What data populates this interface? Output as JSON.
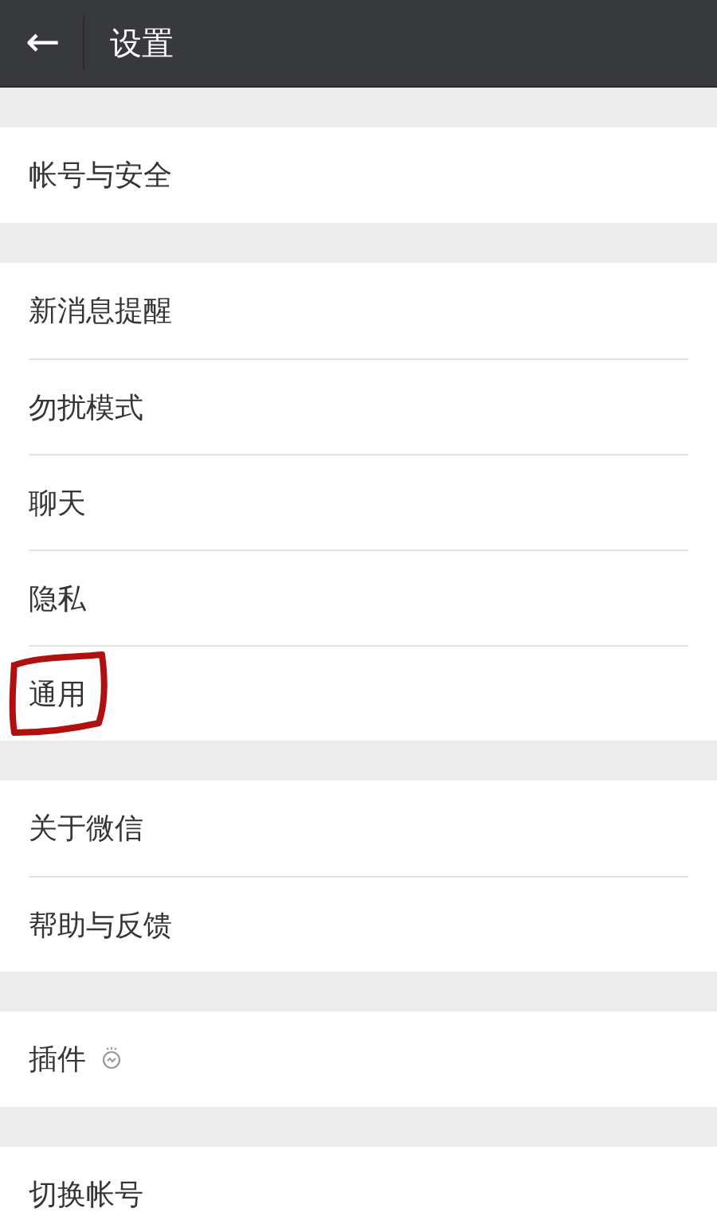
{
  "header": {
    "back": "←",
    "title": "设置"
  },
  "groups": [
    {
      "items": [
        {
          "label": "帐号与安全",
          "highlighted": false,
          "icon": false
        }
      ]
    },
    {
      "items": [
        {
          "label": "新消息提醒",
          "highlighted": false,
          "icon": false
        },
        {
          "label": "勿扰模式",
          "highlighted": false,
          "icon": false
        },
        {
          "label": "聊天",
          "highlighted": false,
          "icon": false
        },
        {
          "label": "隐私",
          "highlighted": false,
          "icon": false
        },
        {
          "label": "通用",
          "highlighted": true,
          "icon": false
        }
      ]
    },
    {
      "items": [
        {
          "label": "关于微信",
          "highlighted": false,
          "icon": false
        },
        {
          "label": "帮助与反馈",
          "highlighted": false,
          "icon": false
        }
      ]
    },
    {
      "items": [
        {
          "label": "插件",
          "highlighted": false,
          "icon": true
        }
      ]
    },
    {
      "items": [
        {
          "label": "切换帐号",
          "highlighted": false,
          "icon": false
        }
      ]
    }
  ]
}
